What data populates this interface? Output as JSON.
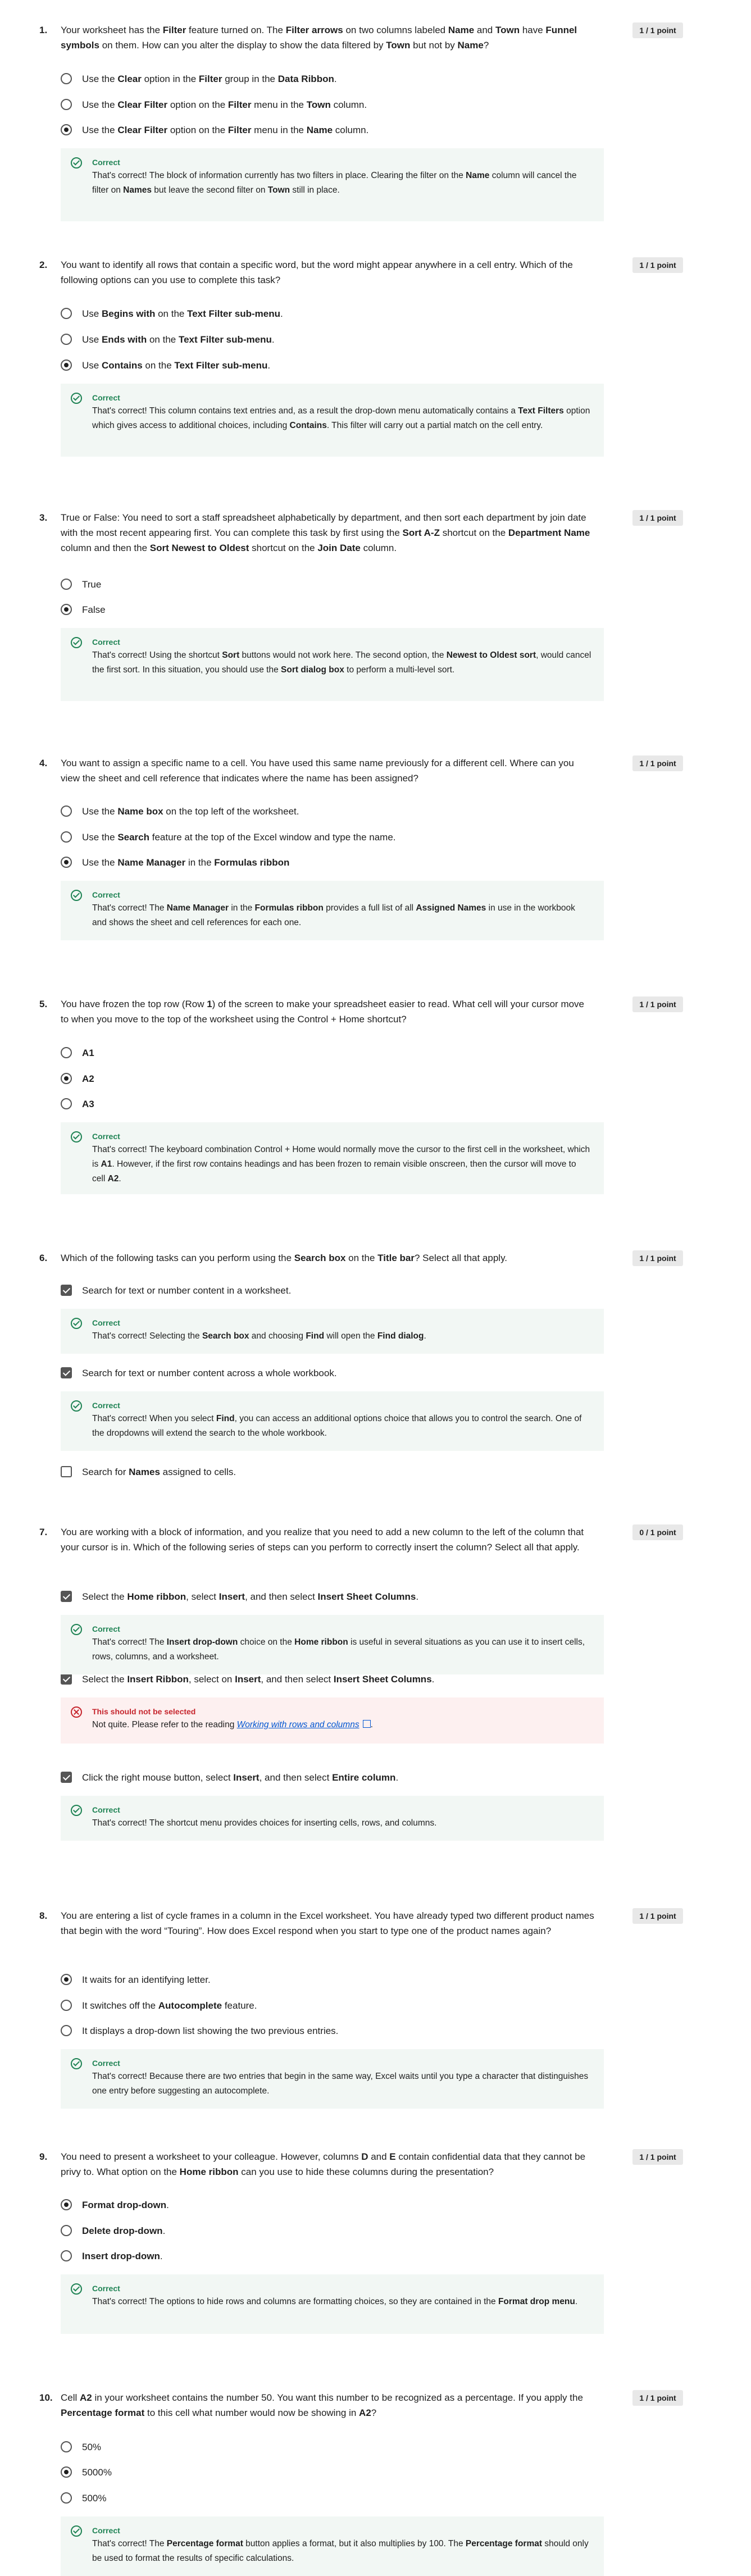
{
  "questions": [
    {
      "number": "1.",
      "points": "1 / 1 point",
      "text": [
        "Your worksheet has the ",
        {
          "b": "Filter"
        },
        " feature turned on. The ",
        {
          "b": "Filter arrows"
        },
        " on two columns labeled ",
        {
          "b": "Name"
        },
        " and ",
        {
          "b": "Town"
        },
        " have ",
        {
          "b": "Funnel symbols"
        },
        " on them. How can you alter the display to show the data filtered by ",
        {
          "b": "Town"
        },
        " but not by ",
        {
          "b": "Name"
        },
        "?"
      ],
      "options": [
        {
          "kind": "radio",
          "selected": false,
          "text": [
            "Use the ",
            {
              "b": "Clear"
            },
            " option in the ",
            {
              "b": "Filter"
            },
            " group in the ",
            {
              "b": "Data Ribbon"
            },
            "."
          ]
        },
        {
          "kind": "radio",
          "selected": false,
          "text": [
            "Use the ",
            {
              "b": "Clear Filter"
            },
            " option on the ",
            {
              "b": "Filter"
            },
            " menu in the ",
            {
              "b": "Town"
            },
            " column."
          ]
        },
        {
          "kind": "radio",
          "selected": true,
          "text": [
            "Use the ",
            {
              "b": "Clear Filter"
            },
            " option on the ",
            {
              "b": "Filter"
            },
            " menu in the ",
            {
              "b": "Name"
            },
            " column."
          ]
        }
      ],
      "feedback": [
        {
          "type": "correct",
          "title": "Correct",
          "text": [
            "That's correct! The block of information currently has two filters in place. Clearing the filter on the ",
            {
              "b": "Name"
            },
            " column will cancel the filter on ",
            {
              "b": "Names"
            },
            " but leave the second filter on ",
            {
              "b": "Town"
            },
            " still in place."
          ]
        }
      ]
    },
    {
      "number": "2.",
      "points": "1 / 1 point",
      "text": [
        "You want to identify all rows that contain a specific word, but the word might appear anywhere in a cell entry. Which of the following options can you use to complete this task?"
      ],
      "options": [
        {
          "kind": "radio",
          "selected": false,
          "text": [
            "Use ",
            {
              "b": "Begins with"
            },
            " on the ",
            {
              "b": "Text Filter sub-menu"
            },
            "."
          ]
        },
        {
          "kind": "radio",
          "selected": false,
          "text": [
            "Use ",
            {
              "b": "Ends with"
            },
            " on the ",
            {
              "b": "Text Filter sub-menu"
            },
            "."
          ]
        },
        {
          "kind": "radio",
          "selected": true,
          "text": [
            "Use ",
            {
              "b": "Contains"
            },
            " on the ",
            {
              "b": "Text Filter sub-menu"
            },
            "."
          ]
        }
      ],
      "feedback": [
        {
          "type": "correct",
          "title": "Correct",
          "text": [
            "That's correct! This column contains text entries and, as a result the drop-down menu automatically contains a ",
            {
              "b": "Text Filters"
            },
            " option which gives access to additional choices, including ",
            {
              "b": "Contains"
            },
            ". This filter will carry out a partial match on the cell entry."
          ]
        }
      ]
    },
    {
      "number": "3.",
      "points": "1 / 1 point",
      "text": [
        "True or False: You need to sort a staff spreadsheet alphabetically by department, and then sort each department by join date with the most recent appearing first. You can complete this task by first using the ",
        {
          "b": "Sort A-Z"
        },
        " shortcut on the ",
        {
          "b": "Department Name"
        },
        " column and then the ",
        {
          "b": "Sort Newest to Oldest"
        },
        " shortcut on the ",
        {
          "b": "Join Date"
        },
        " column."
      ],
      "options": [
        {
          "kind": "radio",
          "selected": false,
          "text": [
            "True"
          ]
        },
        {
          "kind": "radio",
          "selected": true,
          "text": [
            "False"
          ]
        }
      ],
      "feedback": [
        {
          "type": "correct",
          "title": "Correct",
          "text": [
            "That's correct! Using the shortcut ",
            {
              "b": "Sort"
            },
            " buttons would not work here. The second option, the ",
            {
              "b": "Newest to Oldest sort"
            },
            ", would cancel the first sort. In this situation, you should use the ",
            {
              "b": "Sort dialog box"
            },
            " to perform a multi-level sort."
          ]
        }
      ]
    },
    {
      "number": "4.",
      "points": "1 / 1 point",
      "text": [
        "You want to assign a specific name to a cell. You have used this same name previously for a different cell. Where can you view the sheet and cell reference that indicates where the name has been assigned?"
      ],
      "options": [
        {
          "kind": "radio",
          "selected": false,
          "text": [
            "Use the ",
            {
              "b": "Name box"
            },
            " on the top left of the worksheet."
          ]
        },
        {
          "kind": "radio",
          "selected": false,
          "text": [
            "Use the ",
            {
              "b": "Search"
            },
            " feature at the top of the Excel window and type the name."
          ]
        },
        {
          "kind": "radio",
          "selected": true,
          "text": [
            "Use the ",
            {
              "b": "Name Manager"
            },
            " in the ",
            {
              "b": "Formulas ribbon"
            }
          ]
        }
      ],
      "feedback": [
        {
          "type": "correct",
          "title": "Correct",
          "text": [
            "That's correct! The ",
            {
              "b": "Name Manager"
            },
            " in the ",
            {
              "b": "Formulas ribbon"
            },
            " provides a full list of all ",
            {
              "b": "Assigned Names"
            },
            " in use in the workbook and shows the sheet and cell references for each one."
          ]
        }
      ]
    },
    {
      "number": "5.",
      "points": "1 / 1 point",
      "text": [
        "You have frozen the top row (Row ",
        {
          "b": "1"
        },
        ") of the screen to make your spreadsheet easier to read. What cell will your cursor move to when you move to the top of the worksheet using the Control + Home shortcut?"
      ],
      "options": [
        {
          "kind": "radio",
          "selected": false,
          "text": [
            {
              "b": "A1"
            }
          ]
        },
        {
          "kind": "radio",
          "selected": true,
          "text": [
            {
              "b": "A2"
            }
          ]
        },
        {
          "kind": "radio",
          "selected": false,
          "text": [
            {
              "b": "A3"
            }
          ]
        }
      ],
      "feedback": [
        {
          "type": "correct",
          "title": "Correct",
          "text": [
            "That's correct! The keyboard combination Control + Home would normally move the cursor to the first cell in the worksheet, which is ",
            {
              "b": "A1"
            },
            ". However, if the first row contains headings and has been frozen to remain visible onscreen, then the cursor will move to cell ",
            {
              "b": "A2"
            },
            "."
          ]
        }
      ]
    },
    {
      "number": "6.",
      "points": "1 / 1 point",
      "text": [
        "Which of the following tasks can you perform using the ",
        {
          "b": "Search box"
        },
        " on the ",
        {
          "b": "Title bar"
        },
        "? Select all that apply."
      ],
      "options": [
        {
          "kind": "check",
          "selected": true,
          "text": [
            "Search for text or number content in a worksheet."
          ]
        },
        {
          "kind": "check",
          "selected": true,
          "text": [
            "Search for text or number content across a whole workbook."
          ]
        },
        {
          "kind": "check",
          "selected": false,
          "text": [
            "Search for ",
            {
              "b": "Names"
            },
            " assigned to cells."
          ]
        }
      ],
      "feedback": [
        {
          "type": "correct",
          "title": "Correct",
          "text": [
            "That's correct! Selecting the ",
            {
              "b": "Search box"
            },
            " and choosing ",
            {
              "b": "Find"
            },
            " will open the ",
            {
              "b": "Find dialog"
            },
            "."
          ]
        },
        {
          "type": "correct",
          "title": "Correct",
          "text": [
            "That's correct! When you select ",
            {
              "b": "Find"
            },
            ", you can access an additional options choice that allows you to control the search. One of the dropdowns will extend the search to the whole workbook."
          ]
        }
      ]
    },
    {
      "number": "7.",
      "points": "0 / 1 point",
      "text": [
        "You are working with a block of information, and you realize that you need to add a new column to the left of the column that your cursor is in. Which of the following series of steps can you perform to correctly insert the column? Select all that apply."
      ],
      "options": [
        {
          "kind": "check",
          "selected": true,
          "text": [
            "Select the ",
            {
              "b": "Home ribbon"
            },
            ", select ",
            {
              "b": "Insert"
            },
            ", and then select ",
            {
              "b": "Insert Sheet Columns"
            },
            "."
          ]
        },
        {
          "kind": "check",
          "selected": true,
          "text": [
            "Select the ",
            {
              "b": "Insert Ribbon"
            },
            ", select on ",
            {
              "b": "Insert"
            },
            ", and then select ",
            {
              "b": "Insert Sheet Columns"
            },
            "."
          ]
        },
        {
          "kind": "check",
          "selected": true,
          "text": [
            "Click the right mouse button, select ",
            {
              "b": "Insert"
            },
            ", and then select ",
            {
              "b": "Entire column"
            },
            "."
          ]
        }
      ],
      "feedback": [
        {
          "type": "correct",
          "title": "Correct",
          "text": [
            "That's correct! The ",
            {
              "b": "Insert drop-down"
            },
            " choice on the ",
            {
              "b": "Home ribbon"
            },
            " is useful in several situations as you can use it to insert cells, rows, columns, and a worksheet."
          ]
        },
        {
          "type": "wrong",
          "title": "This should not be selected",
          "text": [
            "Not quite. Please refer to the reading "
          ],
          "link": "Working with rows and columns",
          "after": "."
        },
        {
          "type": "correct",
          "title": "Correct",
          "text": [
            "That's correct! The shortcut menu provides choices for inserting cells, rows, and columns."
          ]
        }
      ]
    },
    {
      "number": "8.",
      "points": "1 / 1 point",
      "text": [
        "You are entering a list of cycle frames in a column in the Excel worksheet. You have already typed two different product names that begin with the word “Touring”. How does Excel respond when you start to type one of the product names again?"
      ],
      "options": [
        {
          "kind": "radio",
          "selected": true,
          "text": [
            "It waits for an identifying letter."
          ]
        },
        {
          "kind": "radio",
          "selected": false,
          "text": [
            "It switches off the ",
            {
              "b": "Autocomplete"
            },
            " feature."
          ]
        },
        {
          "kind": "radio",
          "selected": false,
          "text": [
            "It displays a drop-down list showing the two previous entries."
          ]
        }
      ],
      "feedback": [
        {
          "type": "correct",
          "title": "Correct",
          "text": [
            "That's correct! Because there are two entries that begin in the same way, Excel waits until you type a character that distinguishes one entry before suggesting an autocomplete."
          ]
        }
      ]
    },
    {
      "number": "9.",
      "points": "1 / 1 point",
      "text": [
        "You need to present a worksheet to your colleague. However, columns ",
        {
          "b": "D"
        },
        " and ",
        {
          "b": "E"
        },
        " contain confidential data that they cannot be privy to. What option on the ",
        {
          "b": "Home ribbon"
        },
        " can you use to hide these columns during the presentation?"
      ],
      "options": [
        {
          "kind": "radio",
          "selected": true,
          "text": [
            {
              "b": "Format drop-down"
            },
            "."
          ]
        },
        {
          "kind": "radio",
          "selected": false,
          "text": [
            {
              "b": "Delete drop-down"
            },
            "."
          ]
        },
        {
          "kind": "radio",
          "selected": false,
          "text": [
            {
              "b": "Insert drop-down"
            },
            "."
          ]
        }
      ],
      "feedback": [
        {
          "type": "correct",
          "title": "Correct",
          "text": [
            "That's correct! The options to hide rows and columns are formatting choices, so they are contained in the ",
            {
              "b": "Format drop menu"
            },
            "."
          ]
        }
      ]
    },
    {
      "number": "10.",
      "points": "1 / 1 point",
      "text": [
        "Cell ",
        {
          "b": "A2"
        },
        " in your worksheet contains the number 50. You want this number to be recognized as a percentage. If you apply the ",
        {
          "b": "Percentage format"
        },
        " to this cell what number would now be showing in ",
        {
          "b": "A2"
        },
        "?"
      ],
      "options": [
        {
          "kind": "radio",
          "selected": false,
          "text": [
            "50%"
          ]
        },
        {
          "kind": "radio",
          "selected": true,
          "text": [
            "5000%"
          ]
        },
        {
          "kind": "radio",
          "selected": false,
          "text": [
            "500%"
          ]
        }
      ],
      "feedback": [
        {
          "type": "correct",
          "title": "Correct",
          "text": [
            "That's correct! The ",
            {
              "b": "Percentage format"
            },
            " button applies a format, but it also multiplies by 100. The ",
            {
              "b": "Percentage format"
            },
            " should only be used to format the results of specific calculations."
          ]
        }
      ]
    }
  ]
}
